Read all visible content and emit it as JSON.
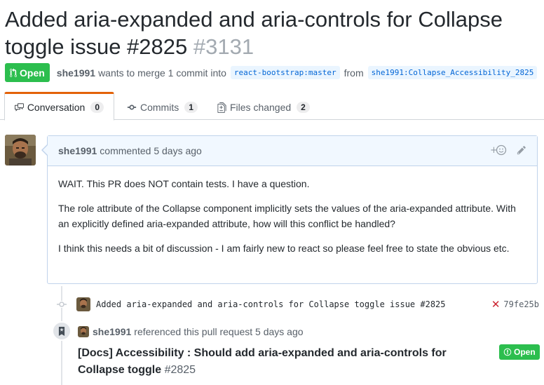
{
  "pr": {
    "title": "Added aria-expanded and aria-controls for Collapse toggle issue #2825",
    "number": "#3131",
    "state": "Open",
    "author": "she1991",
    "merge_text": "wants to merge 1 commit into",
    "base_branch": "react-bootstrap:master",
    "from_text": "from",
    "head_branch": "she1991:Collapse_Accessibility_2825"
  },
  "tabs": [
    {
      "label": "Conversation",
      "count": "0",
      "icon": "comment-discussion-icon"
    },
    {
      "label": "Commits",
      "count": "1",
      "icon": "git-commit-icon"
    },
    {
      "label": "Files changed",
      "count": "2",
      "icon": "file-diff-icon"
    }
  ],
  "comment": {
    "author": "she1991",
    "action": "commented 5 days ago",
    "paragraphs": [
      "WAIT. This PR does NOT contain tests. I have a question.",
      "The role attribute of the Collapse component implicitly sets the values of the aria-expanded attribute. With an explicitly defined aria-expanded attribute, how will this conflict be handled?",
      "I think this needs a bit of discussion - I am fairly new to react so please feel free to state the obvious etc."
    ]
  },
  "commit": {
    "message": "Added aria-expanded and aria-controls for Collapse toggle issue #2825",
    "status": "failure",
    "sha": "79fe25b"
  },
  "reference": {
    "author": "she1991",
    "action": "referenced this pull request 5 days ago",
    "title": "[Docs] Accessibility : Should add aria-expanded and aria-controls for Collapse toggle",
    "number": "#2825",
    "state": "Open"
  },
  "colors": {
    "open_green": "#2cbe4e",
    "tab_accent": "#e36209",
    "comment_header_bg": "#f1f8ff",
    "fail_red": "#cb2431"
  }
}
